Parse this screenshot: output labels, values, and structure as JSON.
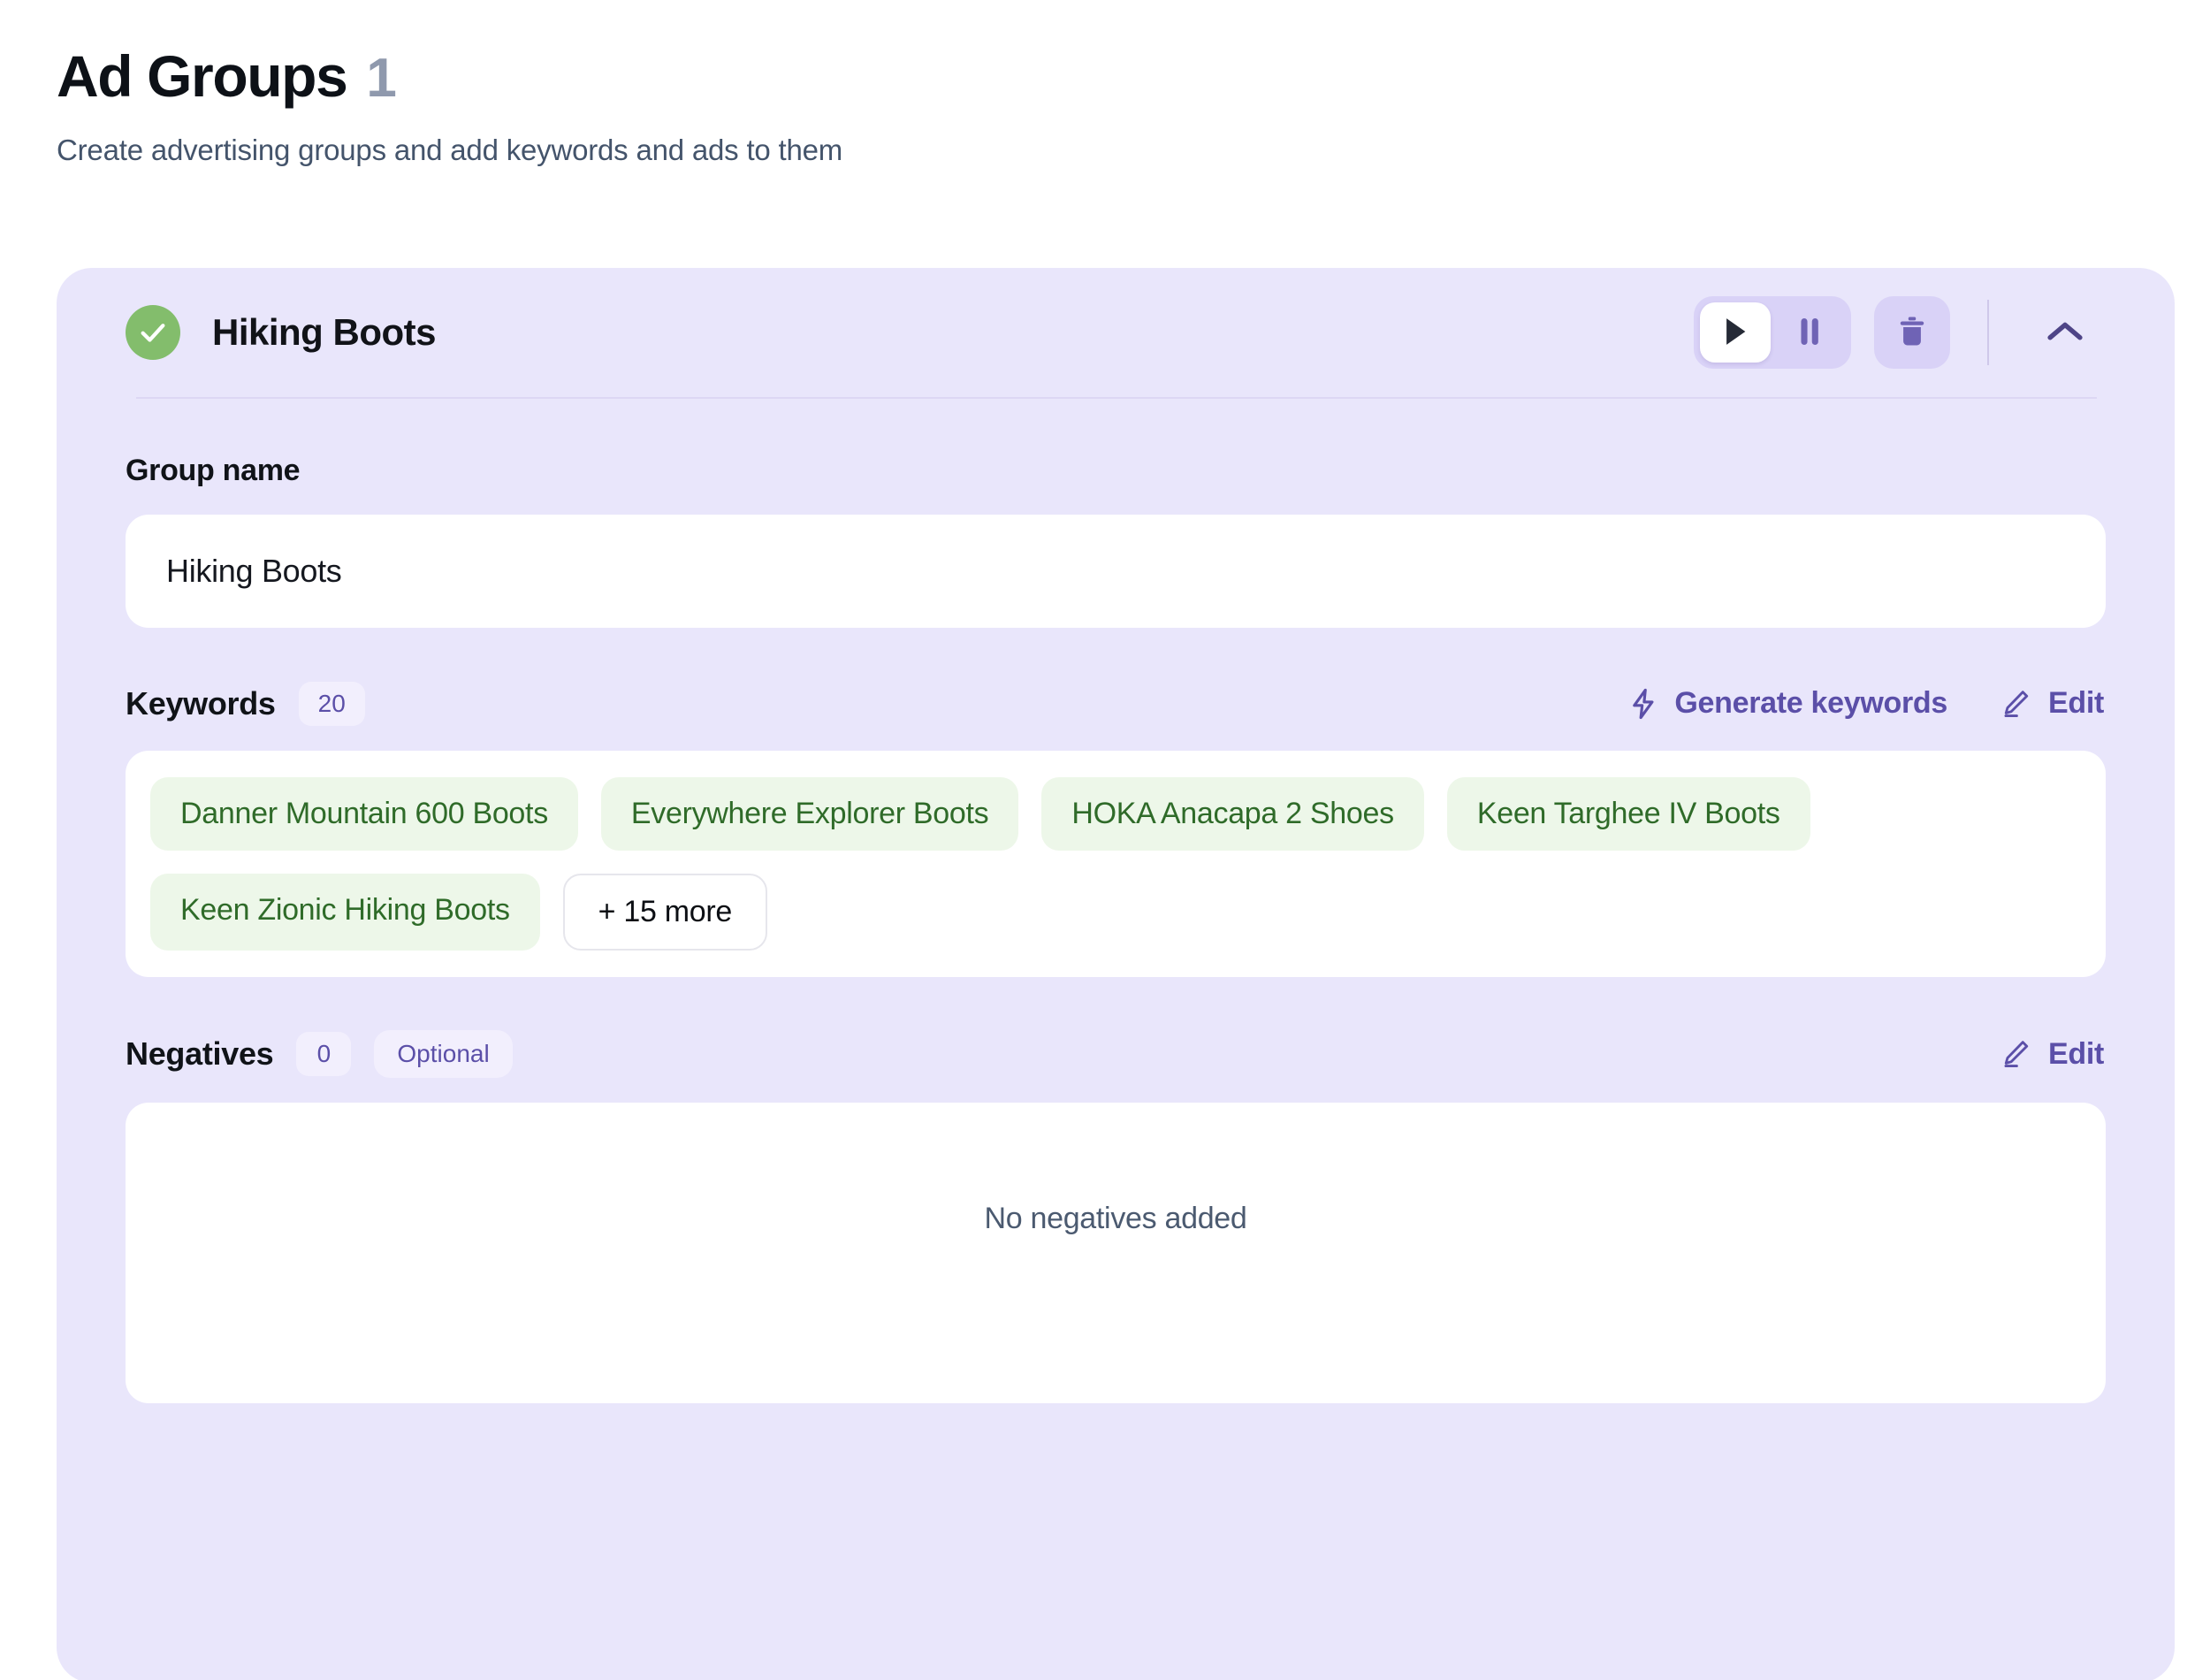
{
  "header": {
    "title": "Ad Groups",
    "count": "1",
    "subtitle": "Create advertising groups and add keywords and ads to them"
  },
  "group": {
    "name": "Hiking Boots",
    "status_icon": "check-circle-icon",
    "controls": {
      "play_icon": "play-icon",
      "pause_icon": "pause-icon",
      "delete_icon": "trash-icon",
      "collapse_icon": "chevron-up-icon",
      "play_active": true
    },
    "group_name_field": {
      "label": "Group name",
      "value": "Hiking Boots",
      "placeholder": "Group name"
    },
    "keywords": {
      "label": "Keywords",
      "count": "20",
      "generate_label": "Generate keywords",
      "generate_icon": "lightning-bolt-icon",
      "edit_label": "Edit",
      "edit_icon": "pencil-icon",
      "items": [
        "Danner Mountain 600 Boots",
        "Everywhere Explorer Boots",
        "HOKA Anacapa 2 Shoes",
        "Keen Targhee IV Boots",
        "Keen Zionic Hiking Boots"
      ],
      "more_label": "+ 15 more"
    },
    "negatives": {
      "label": "Negatives",
      "count": "0",
      "optional_label": "Optional",
      "edit_label": "Edit",
      "edit_icon": "pencil-icon",
      "empty_text": "No negatives added"
    }
  },
  "colors": {
    "card_background": "#e9e6fb",
    "accent_purple": "#5b4fa8",
    "status_green": "#83bd6c",
    "chip_green_bg": "#edf7e9",
    "chip_green_text": "#2f6b29",
    "title_dark": "#0d1117",
    "muted_slate": "#44546b"
  }
}
